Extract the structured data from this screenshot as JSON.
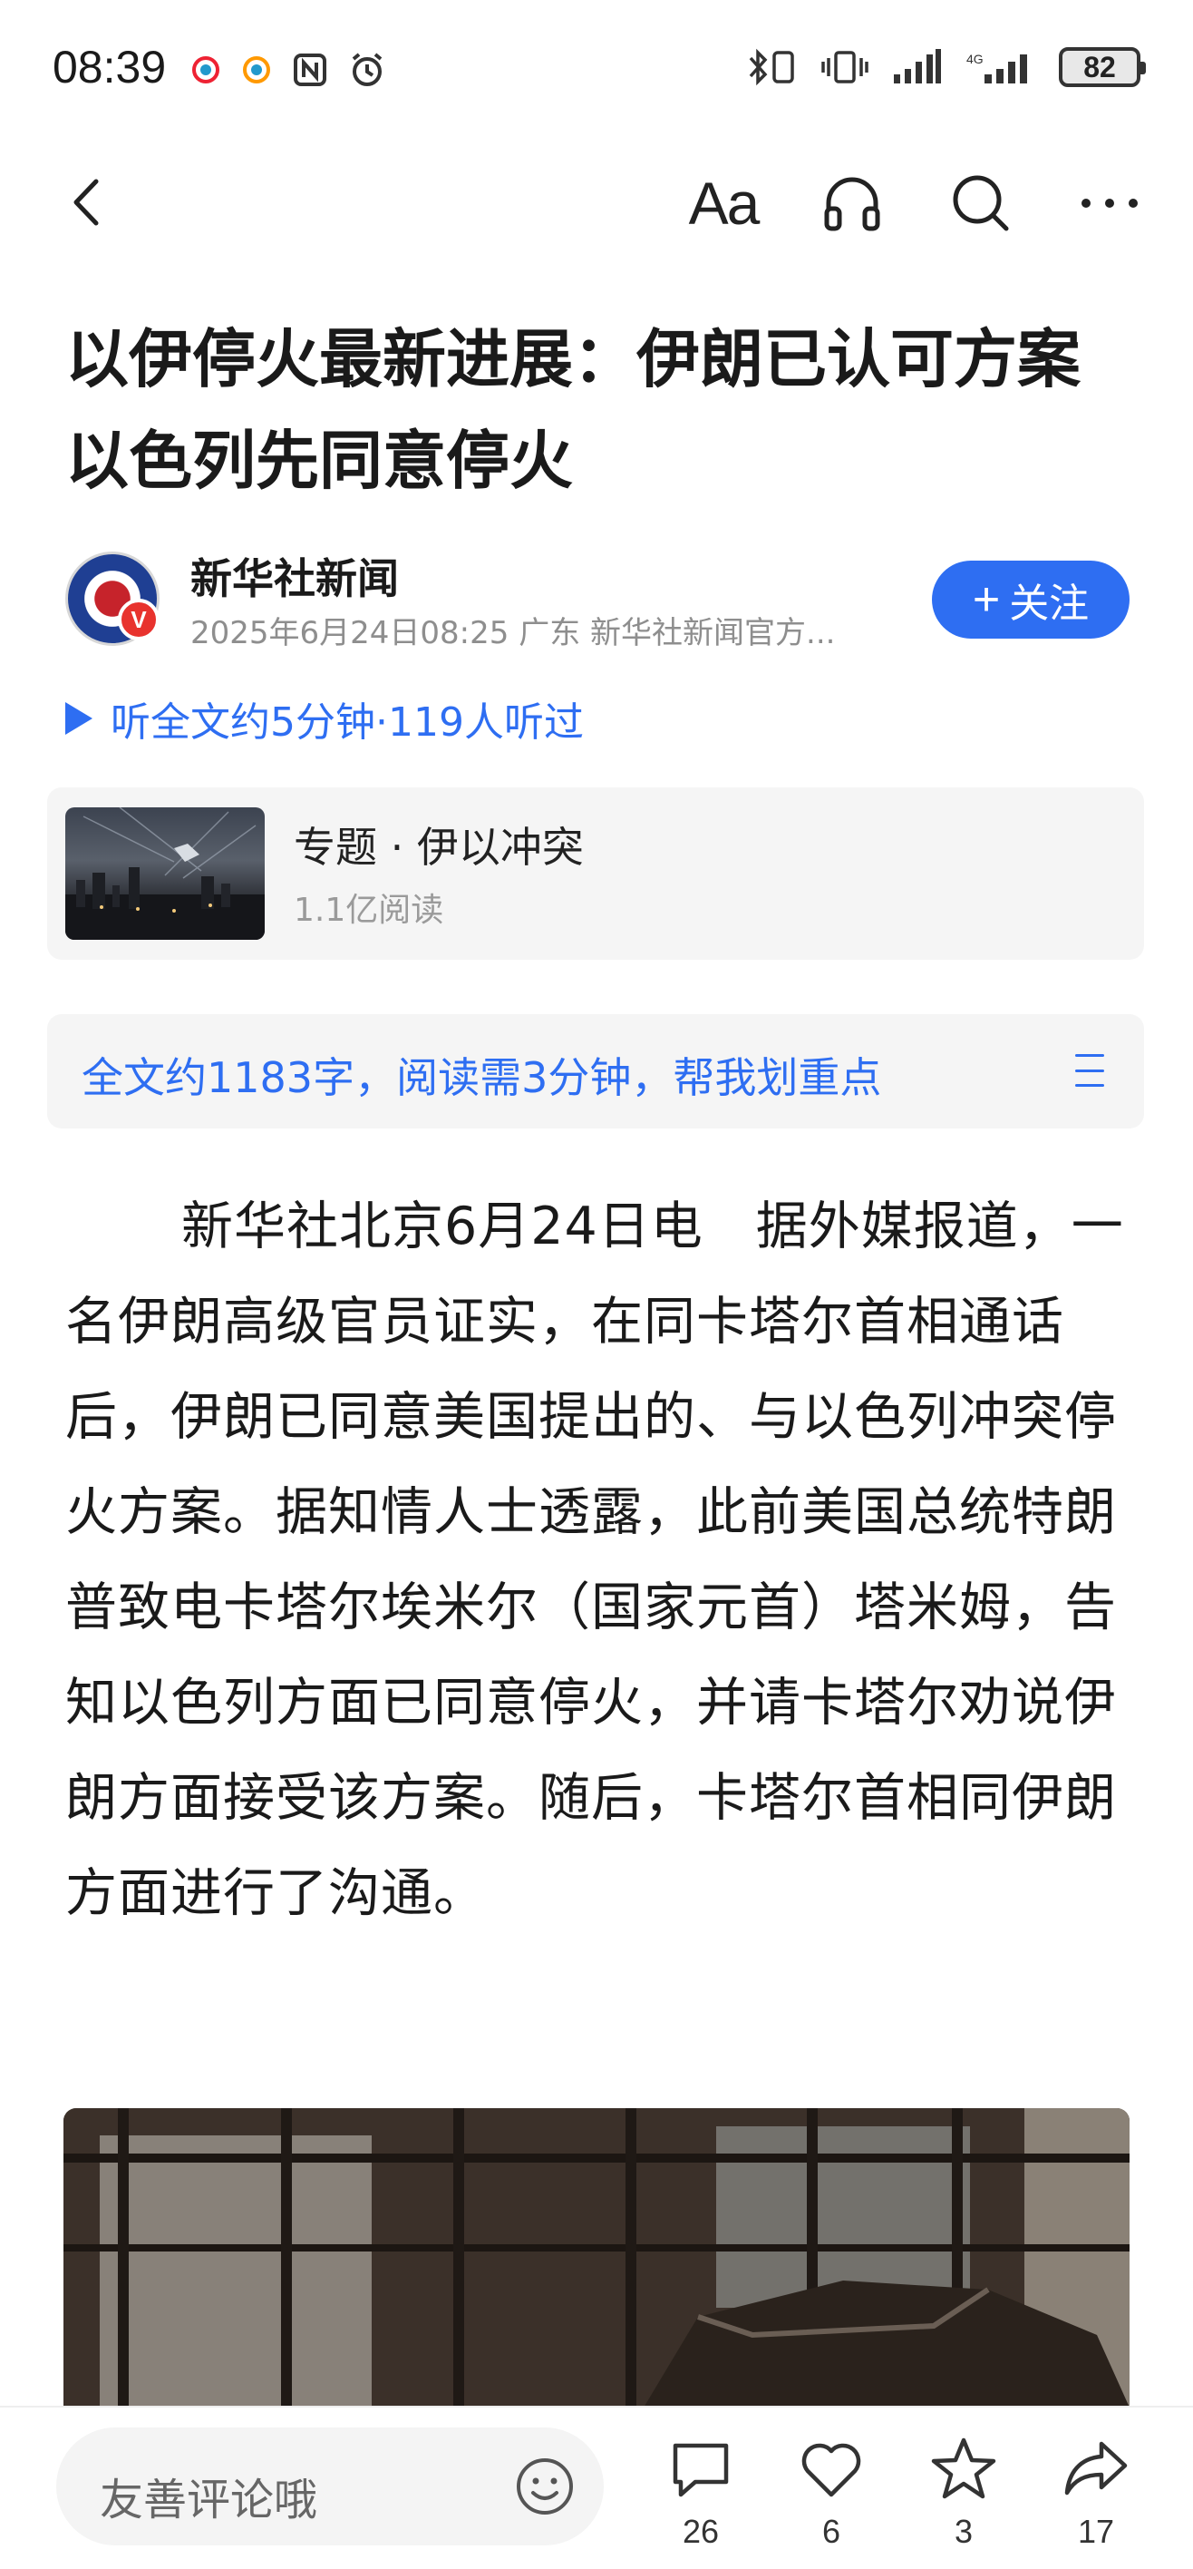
{
  "status_bar": {
    "time": "08:39",
    "battery": "82"
  },
  "toolbar": {
    "font_size_label": "Aa"
  },
  "article": {
    "title": "以伊停火最新进展：伊朗已认可方案 以色列先同意停火",
    "author": "新华社新闻",
    "meta": "2025年6月24日08:25 广东 新华社新闻官方...",
    "follow_label": "关注",
    "listen_label": "听全文约5分钟·119人听过",
    "topic": {
      "title": "专题 · 伊以冲突",
      "reads": "1.1亿阅读"
    },
    "summary_prompt": "全文约1183字，阅读需3分钟，帮我划重点",
    "body": "新华社北京6月24日电　据外媒报道，一名伊朗高级官员证实，在同卡塔尔首相通话后，伊朗已同意美国提出的、与以色列冲突停火方案。据知情人士透露，此前美国总统特朗普致电卡塔尔埃米尔（国家元首）塔米姆，告知以色列方面已同意停火，并请卡塔尔劝说伊朗方面接受该方案。随后，卡塔尔首相同伊朗方面进行了沟通。"
  },
  "bottom_bar": {
    "comment_placeholder": "友善评论哦",
    "comments_count": "26",
    "likes_count": "6",
    "favorites_count": "3",
    "shares_count": "17"
  },
  "colors": {
    "accent": "#2e6ef2",
    "text": "#1a1a1a",
    "muted": "#8e8e8e",
    "card_bg": "#f5f5f5"
  }
}
